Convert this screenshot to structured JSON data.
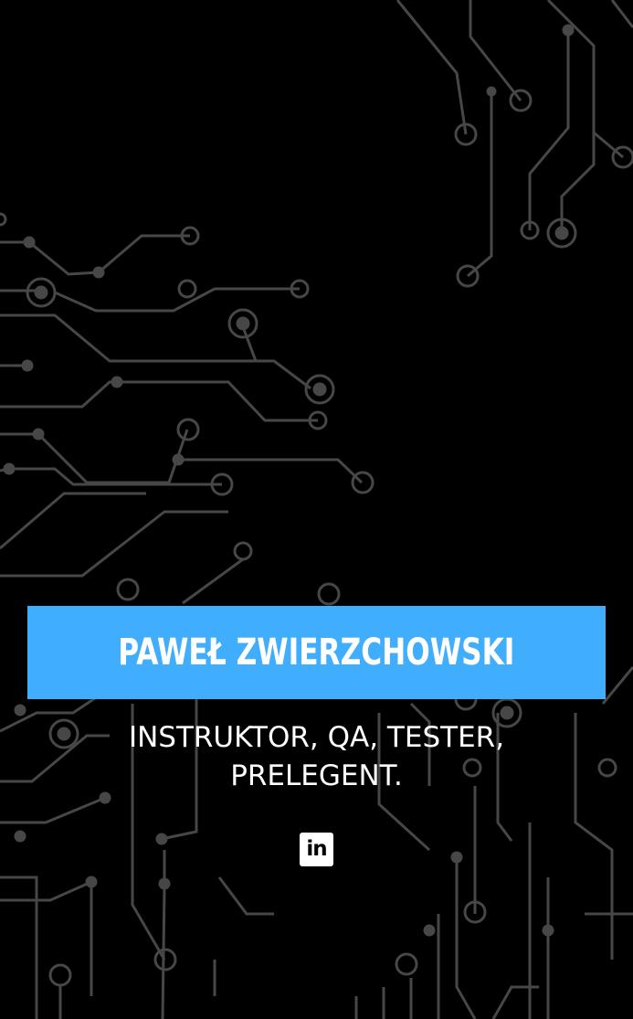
{
  "profile": {
    "name": "PAWEŁ  ZWIERZCHOWSKI",
    "subtitle_line1": "INSTRUKTOR, QA, TESTER,",
    "subtitle_line2": "PRELEGENT."
  },
  "social": {
    "linkedin_glyph": "in",
    "icon": "linkedin-icon"
  },
  "colors": {
    "background": "#000000",
    "banner": "#40aefc",
    "text": "#ffffff",
    "circuit_lines": "#4a4a4a"
  }
}
